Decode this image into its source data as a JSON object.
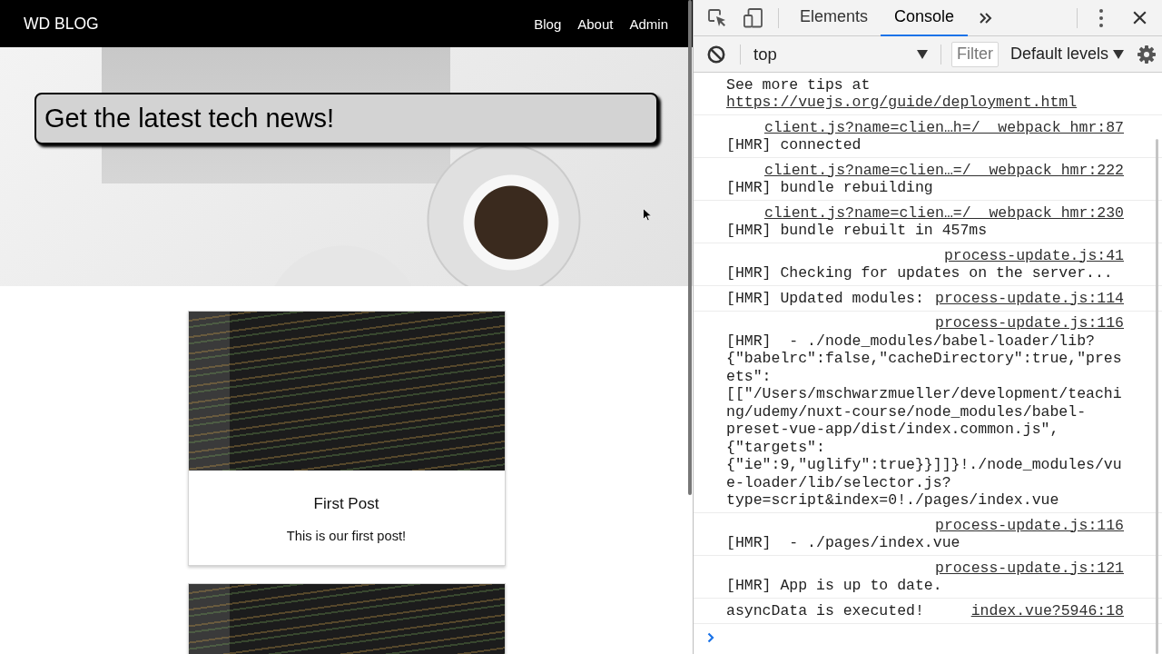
{
  "page": {
    "header": {
      "brand": "WD BLOG",
      "nav": [
        "Blog",
        "About",
        "Admin"
      ]
    },
    "hero": {
      "headline": "Get the latest tech news!"
    },
    "posts": [
      {
        "kind": "full",
        "title": "First Post",
        "preview": "This is our first post!"
      },
      {
        "kind": "partial"
      }
    ]
  },
  "devtools": {
    "tabs": [
      {
        "label": "Elements",
        "selected": false
      },
      {
        "label": "Console",
        "selected": true
      }
    ],
    "toolbar": {
      "context": "top",
      "filter": {
        "placeholder": "Filter"
      },
      "levels": "Default levels"
    },
    "messages": [
      {
        "text": "See more tips at",
        "link": "https://vuejs.org/guide/deployment.html"
      },
      {
        "text": "[HMR] connected",
        "source": "client.js?name=clien…h=/__webpack_hmr:87"
      },
      {
        "text": "[HMR] bundle rebuilding",
        "source": "client.js?name=clien…=/__webpack_hmr:222"
      },
      {
        "text": "[HMR] bundle rebuilt in 457ms",
        "source": "client.js?name=clien…=/__webpack_hmr:230"
      },
      {
        "text": "[HMR] Checking for updates on the server...",
        "source": "process-update.js:41"
      },
      {
        "text": "[HMR] Updated modules:",
        "source": "process-update.js:114"
      },
      {
        "text": "[HMR]  - ./node_modules/babel-loader/lib?{\"babelrc\":false,\"cacheDirectory\":true,\"presets\":[[\"/Users/mschwarzmueller/development/teaching/udemy/nuxt-course/node_modules/babel-preset-vue-app/dist/index.common.js\",{\"targets\":{\"ie\":9,\"uglify\":true}}]]}!./node_modules/vue-loader/lib/selector.js?type=script&index=0!./pages/index.vue",
        "source": "process-update.js:116"
      },
      {
        "text": "[HMR]  - ./pages/index.vue",
        "source": "process-update.js:116"
      },
      {
        "text": "[HMR] App is up to date.",
        "source": "process-update.js:121"
      },
      {
        "text": "asyncData is executed!",
        "source": "index.vue?5946:18"
      }
    ]
  }
}
